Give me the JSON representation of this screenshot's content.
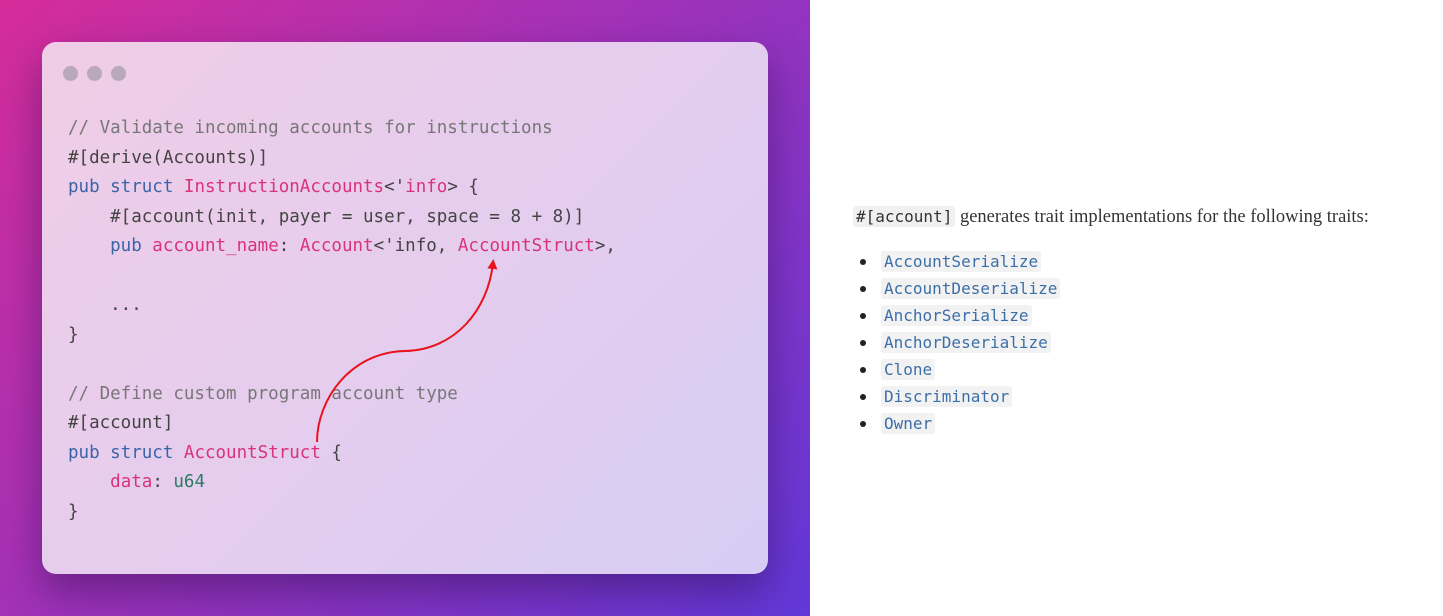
{
  "code_window": {
    "lines": [
      [
        {
          "t": "// Validate incoming accounts for instructions",
          "c": "comment"
        }
      ],
      [
        {
          "t": "#[derive(Accounts)]",
          "c": "plain"
        }
      ],
      [
        {
          "t": "pub struct ",
          "c": "keyword"
        },
        {
          "t": "InstructionAccounts",
          "c": "type"
        },
        {
          "t": "<'",
          "c": "plain"
        },
        {
          "t": "info",
          "c": "type"
        },
        {
          "t": "> {",
          "c": "plain"
        }
      ],
      [
        {
          "t": "    #[account(init, payer = user, space = 8 + 8)]",
          "c": "plain"
        }
      ],
      [
        {
          "t": "    pub ",
          "c": "keyword"
        },
        {
          "t": "account_name",
          "c": "type"
        },
        {
          "t": ": ",
          "c": "plain"
        },
        {
          "t": "Account",
          "c": "type"
        },
        {
          "t": "<'info, ",
          "c": "plain"
        },
        {
          "t": "AccountStruct",
          "c": "type"
        },
        {
          "t": ">,",
          "c": "plain"
        }
      ],
      [
        {
          "t": "",
          "c": "plain"
        }
      ],
      [
        {
          "t": "    ...",
          "c": "plain"
        }
      ],
      [
        {
          "t": "}",
          "c": "plain"
        }
      ],
      [
        {
          "t": "",
          "c": "plain"
        }
      ],
      [
        {
          "t": "// Define custom program account type",
          "c": "comment"
        }
      ],
      [
        {
          "t": "#[account]",
          "c": "plain"
        }
      ],
      [
        {
          "t": "pub struct ",
          "c": "keyword"
        },
        {
          "t": "AccountStruct",
          "c": "type"
        },
        {
          "t": " {",
          "c": "plain"
        }
      ],
      [
        {
          "t": "    ",
          "c": "plain"
        },
        {
          "t": "data",
          "c": "type"
        },
        {
          "t": ": ",
          "c": "plain"
        },
        {
          "t": "u64",
          "c": "prim"
        }
      ],
      [
        {
          "t": "}",
          "c": "plain"
        }
      ]
    ]
  },
  "doc": {
    "intro_code": "#[account]",
    "intro_text": " generates trait implementations for the following traits:",
    "traits": [
      "AccountSerialize",
      "AccountDeserialize",
      "AnchorSerialize",
      "AnchorDeserialize",
      "Clone",
      "Discriminator",
      "Owner"
    ]
  },
  "colors": {
    "keyword": "#3a64a8",
    "type": "#d9327a",
    "primitive": "#2a7a62",
    "comment": "#777777",
    "arrow": "#e8131b",
    "trait_code": "#3c6fa8"
  }
}
